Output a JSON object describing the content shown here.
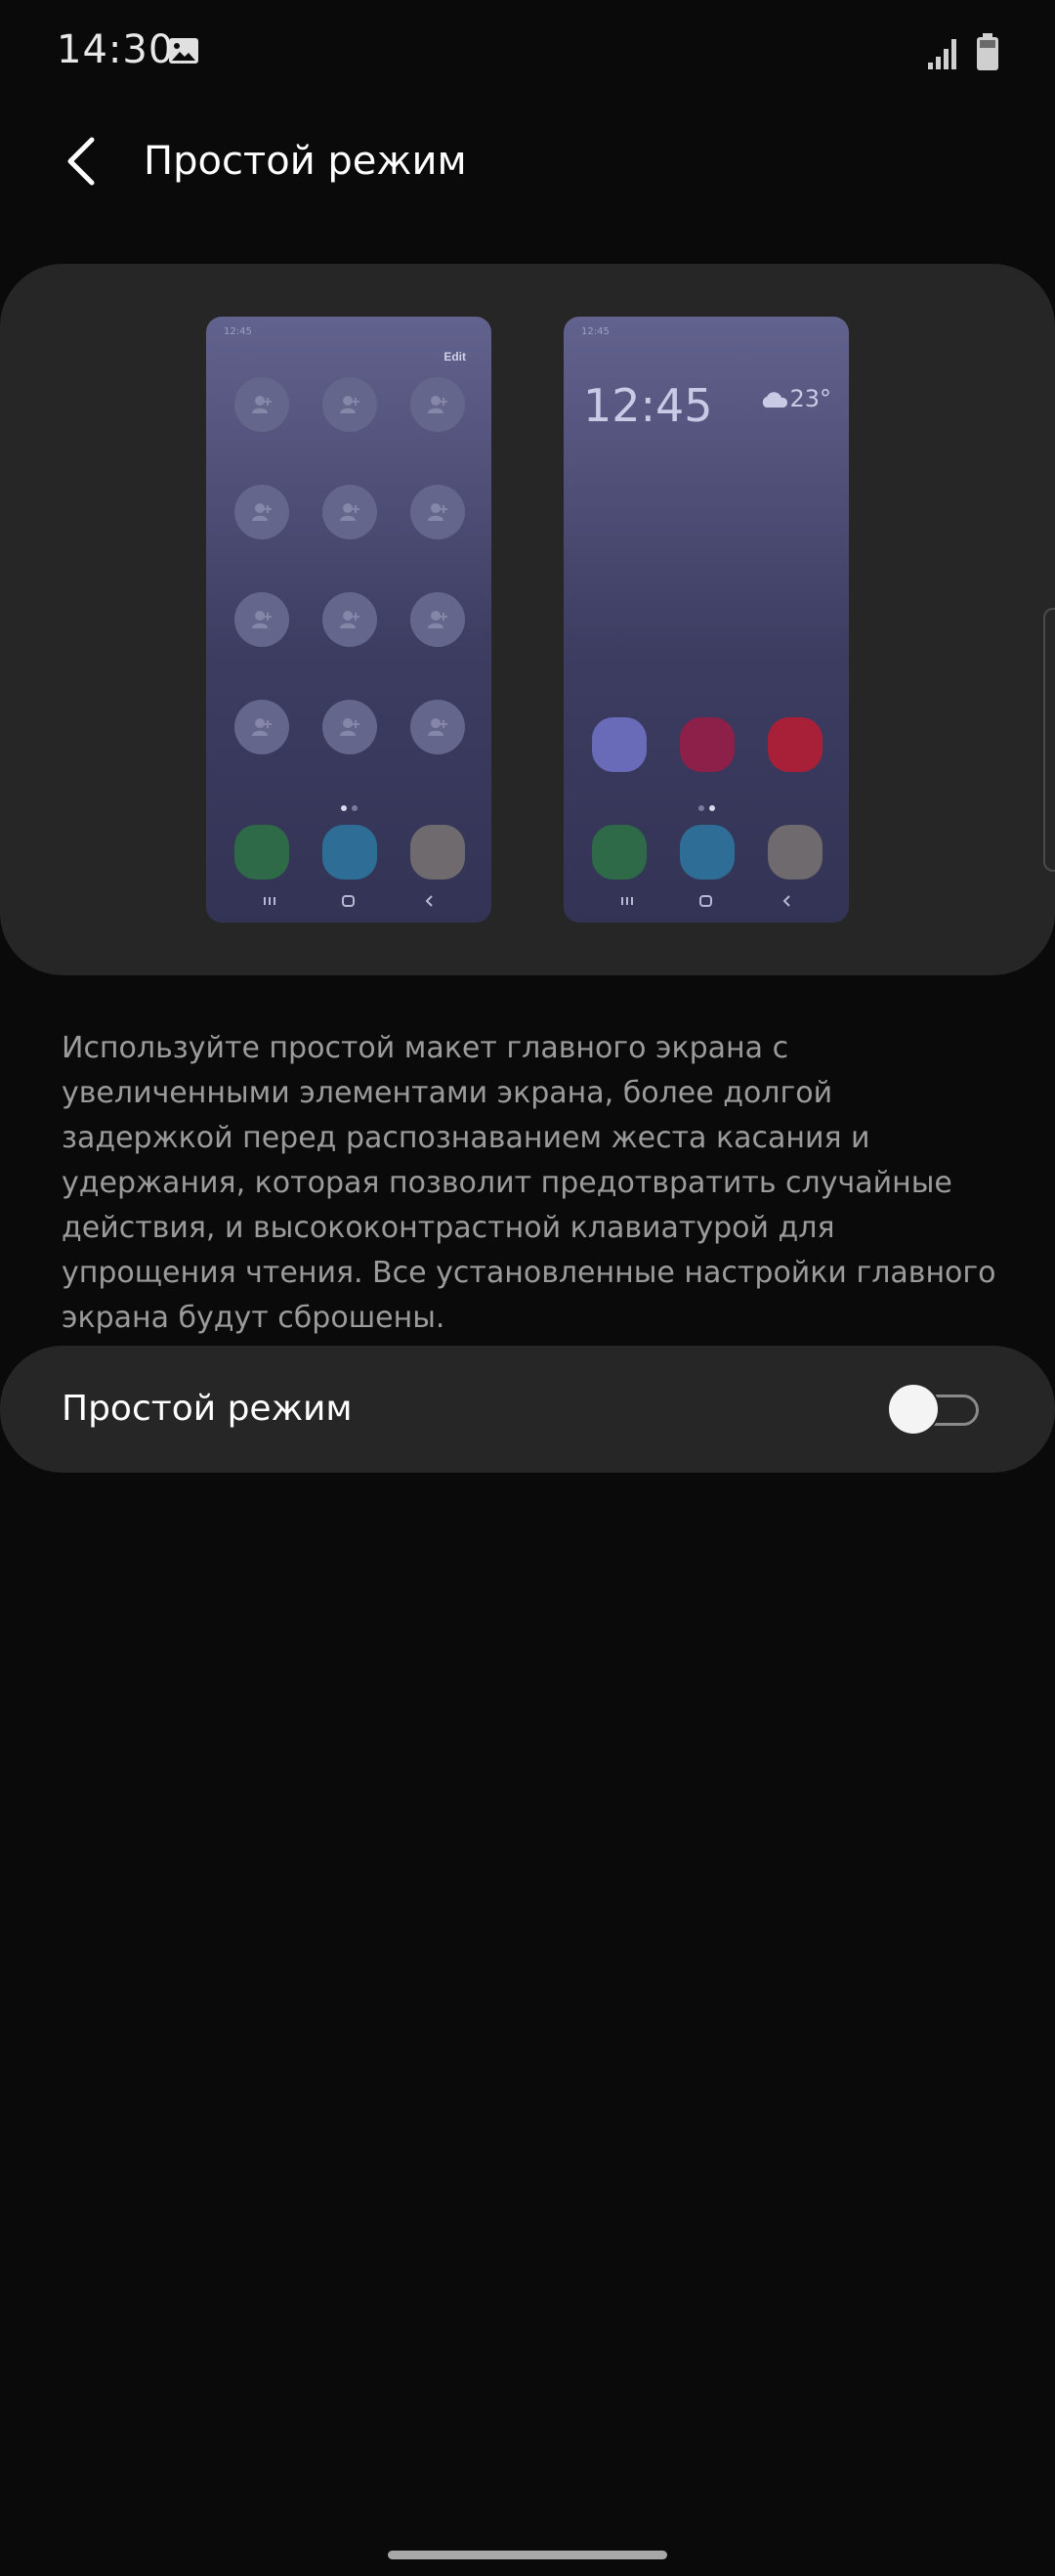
{
  "status_bar": {
    "time": "14:30"
  },
  "header": {
    "title": "Простой режим"
  },
  "preview": {
    "left_phone": {
      "time": "12:45",
      "edit_label": "Edit"
    },
    "right_phone": {
      "time": "12:45",
      "clock": "12:45",
      "temperature": "23°"
    }
  },
  "description": "Используйте простой макет главного экрана с увеличенными элементами экрана, более долгой задержкой перед распознаванием жеста касания и удержания, которая позволит предотвратить случайные действия, и высококонтрастной клавиатурой для упрощения чтения. Все установленные настройки главного экрана будут сброшены.",
  "toggle": {
    "label": "Простой режим",
    "on": false
  },
  "colors": {
    "background": "#0a0a0a",
    "card": "#262626",
    "dock_green": "#2e6a48",
    "dock_blue": "#2e6d96",
    "dock_grey": "#6e6a6e",
    "app_purple": "#6a6bb8",
    "app_crimson": "#8c2048",
    "app_red": "#a82038"
  }
}
